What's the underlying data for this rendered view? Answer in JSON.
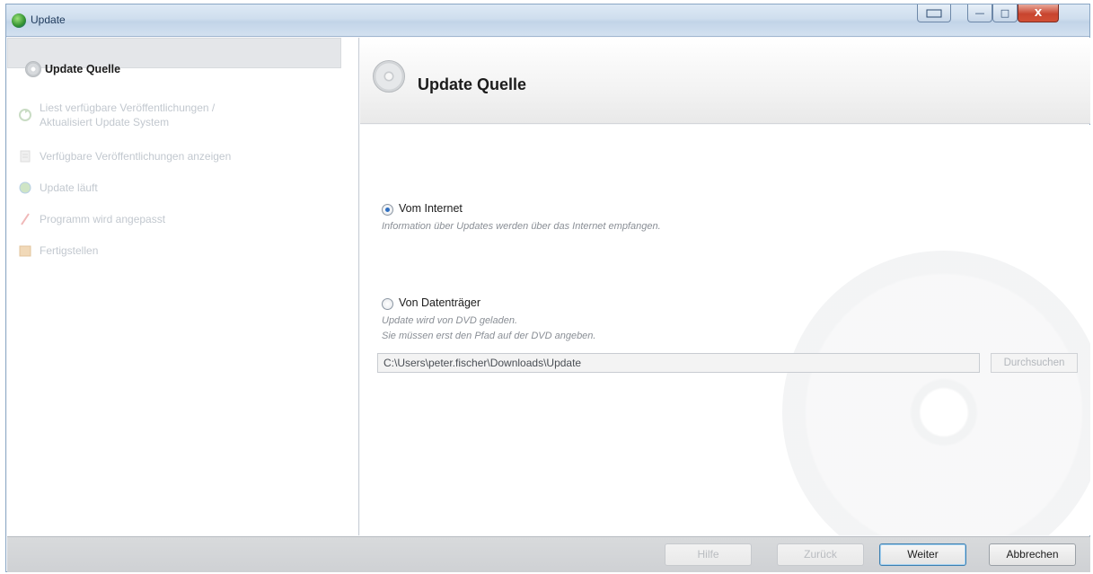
{
  "window": {
    "title": "Update",
    "buttons": {
      "minimize": "—",
      "maximize": "□",
      "close": "X"
    }
  },
  "sidebar": {
    "active_item": "Update Quelle",
    "items": [
      {
        "label_line1": "Liest verfügbare Veröffentlichungen /",
        "label_line2": "Aktualisiert Update System",
        "icon": "sync-icon"
      },
      {
        "label": "Verfügbare Veröffentlichungen anzeigen",
        "icon": "list-icon"
      },
      {
        "label": "Update läuft",
        "icon": "update-globe-icon"
      },
      {
        "label": "Programm wird angepasst",
        "icon": "wand-icon"
      },
      {
        "label": "Fertigstellen",
        "icon": "finish-icon"
      }
    ]
  },
  "header": {
    "title": "Update Quelle",
    "icon": "cd-icon"
  },
  "options": {
    "internet": {
      "label": "Vom Internet",
      "description": "Information über Updates werden über das Internet empfangen.",
      "selected": true
    },
    "media": {
      "label": "Von Datenträger",
      "description_line1": "Update wird von DVD geladen.",
      "description_line2": "Sie müssen erst den Pfad auf der DVD angeben.",
      "selected": false,
      "path_value": "C:\\Users\\peter.fischer\\Downloads\\Update",
      "browse_label": "Durchsuchen"
    }
  },
  "footer": {
    "help": "Hilfe",
    "back": "Zurück",
    "next": "Weiter",
    "cancel": "Abbrechen"
  }
}
